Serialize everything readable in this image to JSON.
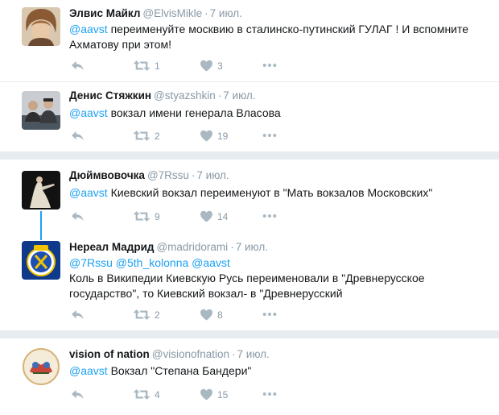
{
  "tweets": [
    {
      "name": "Элвис Майкл",
      "handle": "@ElvisMikle",
      "dot": "·",
      "time": "7 июл.",
      "mentions": "@aavst",
      "text": " переименуйте москвию в сталинско-путинский ГУЛАГ ! И вспомните Ахматову при этом!",
      "retweets": "1",
      "likes": "3"
    },
    {
      "name": "Денис Стяжкин",
      "handle": "@styazshkin",
      "dot": "·",
      "time": "7 июл.",
      "mentions": "@aavst",
      "text": " вокзал имени генерала Власова",
      "retweets": "2",
      "likes": "19"
    },
    {
      "name": "Дюймвовочка",
      "handle": "@7Rssu",
      "dot": "·",
      "time": "7 июл.",
      "mentions": "@aavst",
      "text": " Киевский вокзал переименуют в \"Мать вокзалов Московских\"",
      "retweets": "9",
      "likes": "14"
    },
    {
      "name": "Нереал Мадрид",
      "handle": "@madridorami",
      "dot": "·",
      "time": "7 июл.",
      "mentions": "@7Rssu @5th_kolonna @aavst",
      "text": "Коль в Википедии Киевскую Русь переименовали в \"Древнерусское государство\", то Киевский вокзал- в \"Древнерусский",
      "retweets": "2",
      "likes": "8"
    },
    {
      "name": "vision of nation",
      "handle": "@visionofnation",
      "dot": "·",
      "time": "7 июл.",
      "mentions": "@aavst",
      "text": " Вокзал \"Степана Бандери\"",
      "retweets": "4",
      "likes": "15"
    }
  ],
  "colors": {
    "accent": "#1da1f2",
    "secondary_text": "#8899a6",
    "icon": "#aab8c2",
    "separator": "#e6ecf0"
  },
  "icons": [
    "reply-icon",
    "retweet-icon",
    "like-icon",
    "more-icon"
  ]
}
